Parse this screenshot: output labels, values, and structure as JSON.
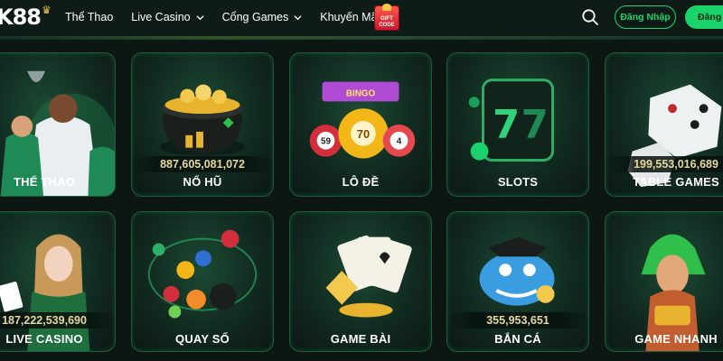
{
  "header": {
    "logo_text": "K88",
    "nav": [
      {
        "label": "Thể Thao",
        "has_dropdown": false
      },
      {
        "label": "Live Casino",
        "has_dropdown": true
      },
      {
        "label": "Cổng Games",
        "has_dropdown": true
      },
      {
        "label": "Khuyến Mãi",
        "has_dropdown": true
      }
    ],
    "gift_badge": {
      "line1": "GIFT",
      "line2": "CODE"
    },
    "login_label": "Đăng Nhập",
    "signup_label": "Đăng"
  },
  "colors": {
    "accent": "#1ad36b",
    "background": "#0c1714",
    "jackpot_text": "#e8d79a"
  },
  "games": [
    {
      "label": "THỂ THAO",
      "jackpot": null
    },
    {
      "label": "NỔ HŨ",
      "jackpot": "887,605,081,072"
    },
    {
      "label": "LÔ ĐỀ",
      "jackpot": null
    },
    {
      "label": "SLOTS",
      "jackpot": null
    },
    {
      "label": "TABLE GAMES",
      "jackpot": "199,553,016,689"
    },
    {
      "label": "LIVE CASINO",
      "jackpot": "187,222,539,690"
    },
    {
      "label": "QUAY SỐ",
      "jackpot": null
    },
    {
      "label": "GAME BÀI",
      "jackpot": null
    },
    {
      "label": "BẮN CÁ",
      "jackpot": "355,953,651"
    },
    {
      "label": "GAME NHANH",
      "jackpot": null
    }
  ],
  "art_text": {
    "lotto_balls": [
      "59",
      "70",
      "4"
    ],
    "bingo_sign": "BINGO"
  },
  "icons": [
    "search-icon",
    "chevron-down-icon",
    "gift-icon"
  ]
}
